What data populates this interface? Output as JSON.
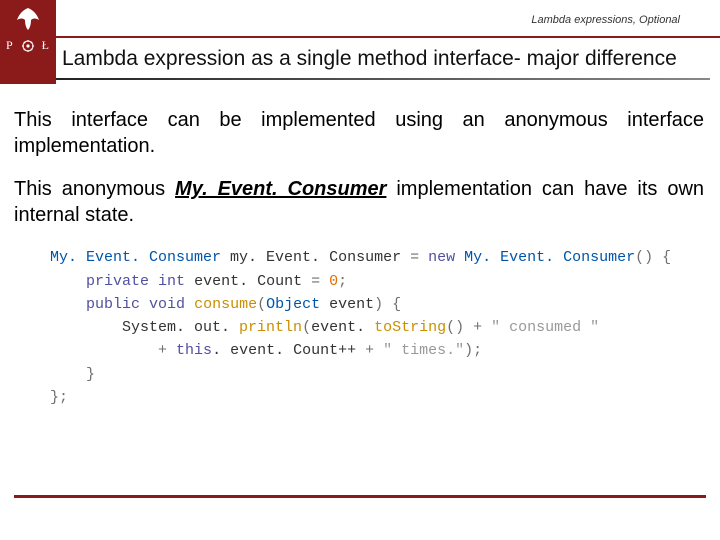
{
  "header": {
    "breadcrumb": "Lambda expressions, Optional",
    "title": "Lambda expression as a single method interface- major difference",
    "logo": {
      "left_letter": "P",
      "right_letter": "Ł"
    }
  },
  "body": {
    "para1": "This interface can be implemented using an anonymous interface implementation.",
    "para2_pre": "This anonymous ",
    "para2_em": "My. Event. Consumer",
    "para2_post": " implementation can have its own internal state."
  },
  "code": {
    "l1": {
      "type1": "My. Event. Consumer",
      "var": "my. Event. Consumer",
      "eq": " = ",
      "kw_new": "new",
      "type2": "My. Event. Consumer",
      "tail": "() {"
    },
    "l2": {
      "kw1": "private",
      "kw2": "int",
      "var": "event. Count",
      "eq": " = ",
      "num": "0",
      "tail": ";"
    },
    "l3": {
      "kw1": "public",
      "kw2": "void",
      "method": "consume",
      "open": "(",
      "argty": "Object",
      "arg": "event",
      "tail": ") {"
    },
    "l4": {
      "call1": "System. out. ",
      "method": "println",
      "open": "(",
      "expr": "event. ",
      "m2": "toString",
      "paren": "()",
      "plus": " + ",
      "str": "\" consumed \""
    },
    "l5": {
      "plus1": "+ ",
      "kw_this": "this",
      "dot": ". event. Count++ ",
      "plus2": "+ ",
      "str": "\" times.\"",
      "tail": ");"
    },
    "l6": {
      "brace": "}"
    },
    "l7": {
      "tail": "};"
    }
  }
}
